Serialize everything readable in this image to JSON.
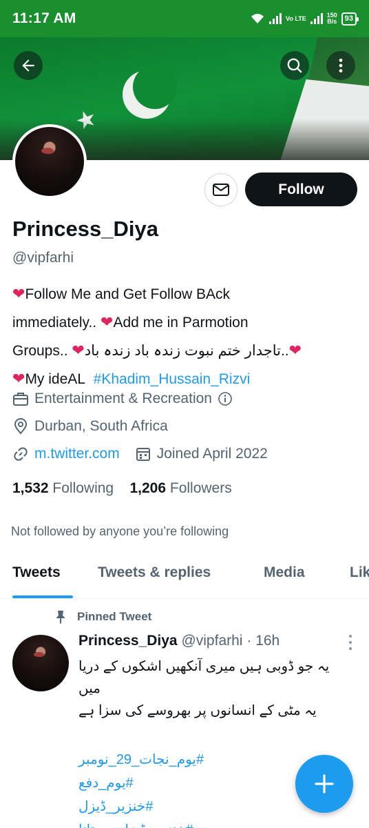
{
  "status_bar": {
    "time": "11:17 AM",
    "network_label": "Vo LTE",
    "speed": "150",
    "speed_unit": "B/s",
    "battery": "93"
  },
  "banner": {
    "back_icon": "arrow-left-icon",
    "search_icon": "search-icon",
    "more_icon": "more-vertical-icon"
  },
  "profile": {
    "name": "Princess_Diya",
    "handle": "@vipfarhi",
    "follow_label": "Follow",
    "message_icon": "mail-icon",
    "bio": {
      "line1": "Follow Me and Get Follow BAck",
      "line2_a": "immediately..",
      "line2_b": "Add me in Parmotion",
      "line3_a": "Groups..",
      "line3_b": "..تاجدار ختم نبوت زندہ باد زندہ باد",
      "line4_a": "My ideAL",
      "line4_link": "#Khadim_Hussain_Rizvi"
    },
    "category": "Entertainment & Recreation",
    "location": "Durban, South Africa",
    "website": "m.twitter.com",
    "joined": "Joined April 2022",
    "following_count": "1,532",
    "following_label": "Following",
    "followers_count": "1,206",
    "followers_label": "Followers",
    "not_followed": "Not followed by anyone you’re following"
  },
  "tabs": [
    {
      "label": "Tweets"
    },
    {
      "label": "Tweets & replies"
    },
    {
      "label": "Media"
    },
    {
      "label": "Likes"
    }
  ],
  "tweet": {
    "pinned_label": "Pinned Tweet",
    "author": "Princess_Diya",
    "handle": "@vipfarhi",
    "time": "· 16h",
    "line1": "یہ جو ڈوبی ہیں میری آنکھیں اشکوں کے دریا",
    "line2": "میں",
    "line3": "یہ مٹی کے انسانوں پر بھروسے کی سزا ہے",
    "hashtags": [
      "#یوم_نجات_29_نومبر",
      "#یوم_دفع",
      "#خنزیر_ڈیزل",
      "#خنزیر_ڈیزل_بستانا"
    ]
  },
  "fab": {
    "icon": "plus-icon"
  }
}
